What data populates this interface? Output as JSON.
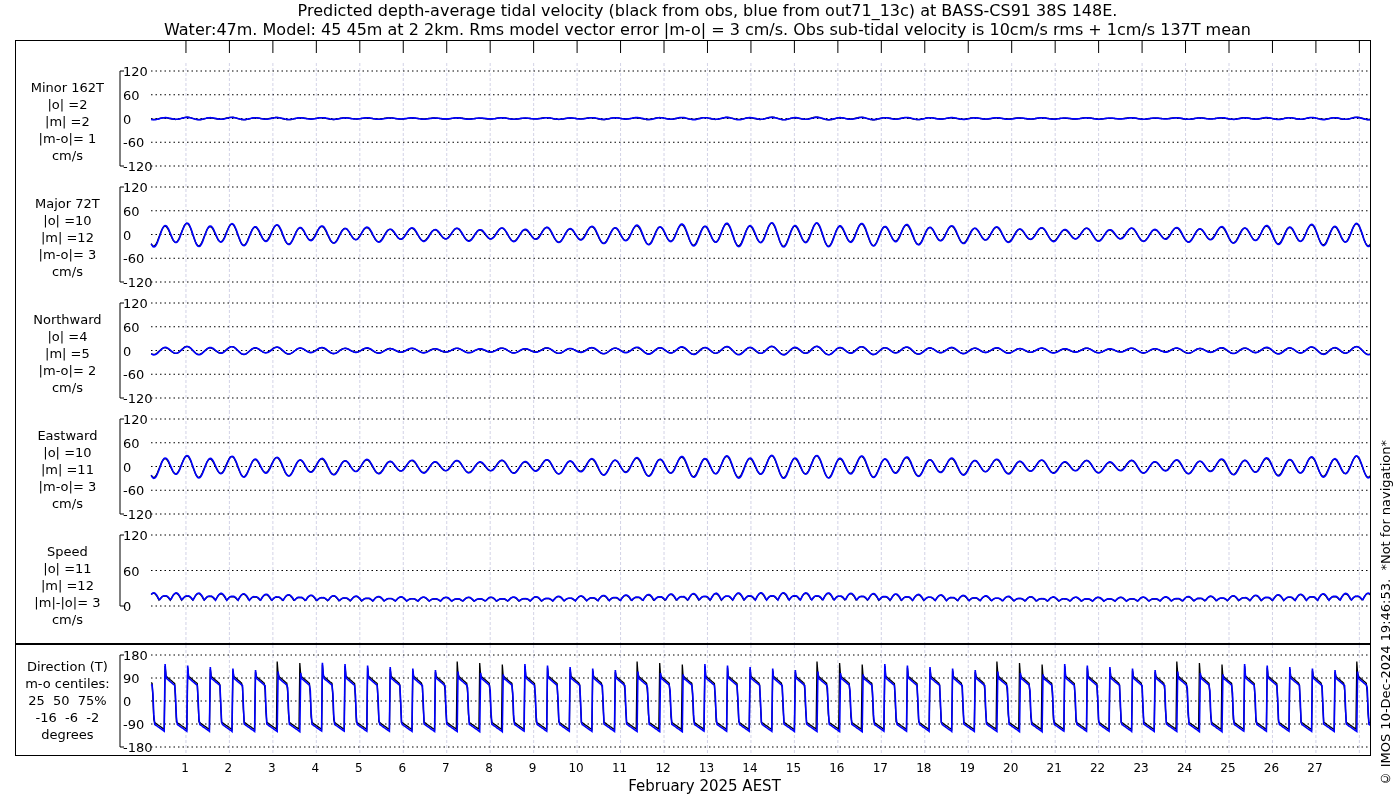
{
  "title_lines": [
    "Predicted depth-average tidal velocity (black from obs, blue from out71_13c) at BASS-CS91 38S 148E.",
    "Water:47m. Model: 45 45m at 2 2km. Rms model vector error |m-o| = 3 cm/s. Obs sub-tidal velocity is 10cm/s rms + 1cm/s 137T mean"
  ],
  "panels": [
    {
      "kind": "velocity",
      "label_lines": [
        "Minor 162T",
        "|o| =2",
        "|m| =2",
        "|m-o|= 1",
        "cm/s"
      ],
      "yticks": [
        "120",
        "60",
        "0",
        "-60",
        "-120"
      ]
    },
    {
      "kind": "velocity",
      "label_lines": [
        "Major 72T",
        "|o| =10",
        "|m| =12",
        "|m-o|= 3",
        "cm/s"
      ],
      "yticks": [
        "120",
        "60",
        "0",
        "-60",
        "-120"
      ]
    },
    {
      "kind": "velocity",
      "label_lines": [
        "Northward",
        "|o| =4",
        "|m| =5",
        "|m-o|= 2",
        "cm/s"
      ],
      "yticks": [
        "120",
        "60",
        "0",
        "-60",
        "-120"
      ]
    },
    {
      "kind": "velocity",
      "label_lines": [
        "Eastward",
        "|o| =10",
        "|m| =11",
        "|m-o|= 3",
        "cm/s"
      ],
      "yticks": [
        "120",
        "60",
        "0",
        "-60",
        "-120"
      ]
    },
    {
      "kind": "speed",
      "label_lines": [
        "Speed",
        "|o| =11",
        "|m| =12",
        "|m|-|o|= 3",
        "cm/s"
      ],
      "yticks": [
        "120",
        "60",
        "0"
      ]
    }
  ],
  "direction_panel": {
    "kind": "direction",
    "label_lines": [
      "Direction (T)",
      "m-o centiles:",
      "25  50  75%",
      "-16  -6  -2",
      "degrees"
    ],
    "yticks": [
      "180",
      "90",
      "0",
      "-90",
      "-180"
    ]
  },
  "x_axis": {
    "labels": [
      "1",
      "2",
      "3",
      "4",
      "5",
      "6",
      "7",
      "8",
      "9",
      "10",
      "11",
      "12",
      "13",
      "14",
      "15",
      "16",
      "17",
      "18",
      "19",
      "20",
      "21",
      "22",
      "23",
      "24",
      "25",
      "26",
      "27"
    ],
    "title": "February 2025 AEST"
  },
  "footer": "© IMOS 10-Dec-2024 19:46:53.  *Not for navigation*"
}
